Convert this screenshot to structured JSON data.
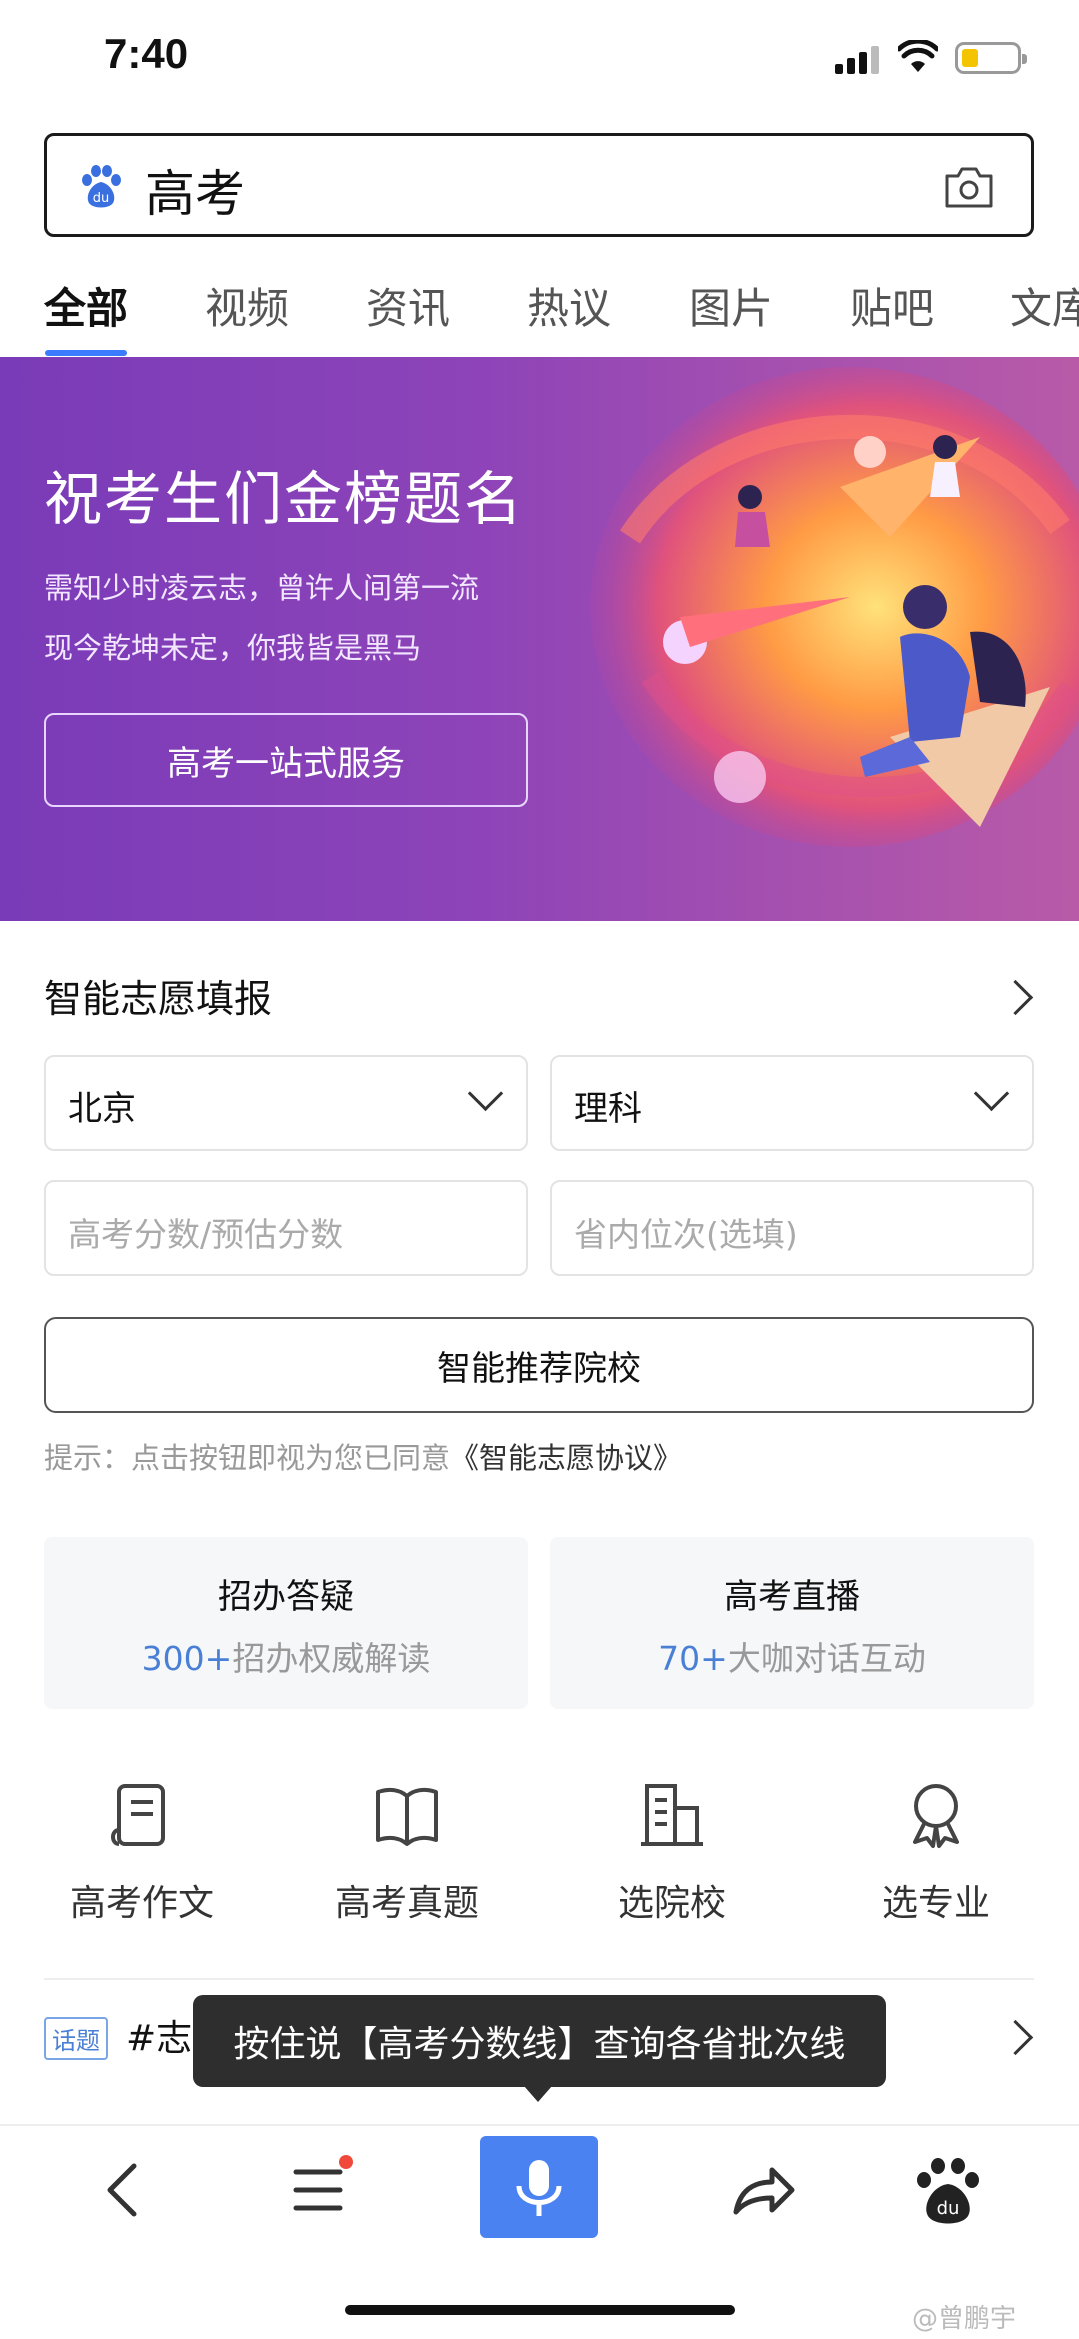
{
  "status_bar": {
    "time": "7:40"
  },
  "search": {
    "query": "高考"
  },
  "tabs": [
    {
      "label": "全部",
      "active": true
    },
    {
      "label": "视频"
    },
    {
      "label": "资讯"
    },
    {
      "label": "热议"
    },
    {
      "label": "图片"
    },
    {
      "label": "贴吧"
    },
    {
      "label": "文库"
    }
  ],
  "banner": {
    "title": "祝考生们金榜题名",
    "line1": "需知少时凌云志，曾许人间第一流",
    "line2": "现今乾坤未定，你我皆是黑马",
    "button": "高考一站式服务"
  },
  "volunteer": {
    "title": "智能志愿填报",
    "province": "北京",
    "subject": "理科",
    "score_placeholder": "高考分数/预估分数",
    "rank_placeholder": "省内位次(选填)",
    "submit": "智能推荐院校",
    "hint_prefix": "提示：点击按钮即视为您已同意",
    "hint_link": "《智能志愿协议》"
  },
  "cards": [
    {
      "title": "招办答疑",
      "num": "300+",
      "desc": "招办权威解读"
    },
    {
      "title": "高考直播",
      "num": "70+",
      "desc": "大咖对话互动"
    }
  ],
  "quick_links": [
    {
      "label": "高考作文",
      "icon": "document-icon"
    },
    {
      "label": "高考真题",
      "icon": "book-icon"
    },
    {
      "label": "选院校",
      "icon": "building-icon"
    },
    {
      "label": "选专业",
      "icon": "award-icon"
    }
  ],
  "topic": {
    "tag": "话题",
    "text": "#志愿填报"
  },
  "tooltip": "按住说【高考分数线】查询各省批次线",
  "watermark": "@曾鹏宇"
}
